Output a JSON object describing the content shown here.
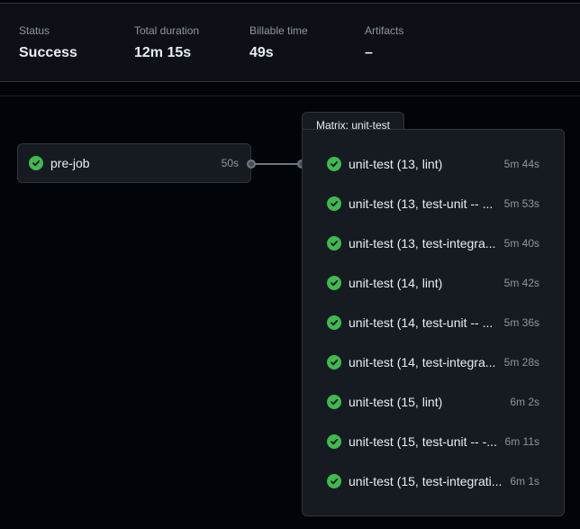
{
  "summary": {
    "status": {
      "label": "Status",
      "value": "Success"
    },
    "total_duration": {
      "label": "Total duration",
      "value": "12m 15s"
    },
    "billable_time": {
      "label": "Billable time",
      "value": "49s"
    },
    "artifacts": {
      "label": "Artifacts",
      "value": "–"
    }
  },
  "pre_job": {
    "name": "pre-job",
    "duration": "50s",
    "status": "success"
  },
  "matrix": {
    "title": "Matrix: unit-test",
    "jobs": [
      {
        "name": "unit-test (13, lint)",
        "duration": "5m 44s",
        "status": "success"
      },
      {
        "name": "unit-test (13, test-unit -- ...",
        "duration": "5m 53s",
        "status": "success"
      },
      {
        "name": "unit-test (13, test-integra...",
        "duration": "5m 40s",
        "status": "success"
      },
      {
        "name": "unit-test (14, lint)",
        "duration": "5m 42s",
        "status": "success"
      },
      {
        "name": "unit-test (14, test-unit -- ...",
        "duration": "5m 36s",
        "status": "success"
      },
      {
        "name": "unit-test (14, test-integra...",
        "duration": "5m 28s",
        "status": "success"
      },
      {
        "name": "unit-test (15, lint)",
        "duration": "6m 2s",
        "status": "success"
      },
      {
        "name": "unit-test (15, test-unit -- -...",
        "duration": "6m 11s",
        "status": "success"
      },
      {
        "name": "unit-test (15, test-integrati...",
        "duration": "6m 1s",
        "status": "success"
      }
    ]
  },
  "colors": {
    "success": "#3fb950",
    "background": "#010409",
    "panel": "#161b22",
    "border": "#30363d"
  }
}
